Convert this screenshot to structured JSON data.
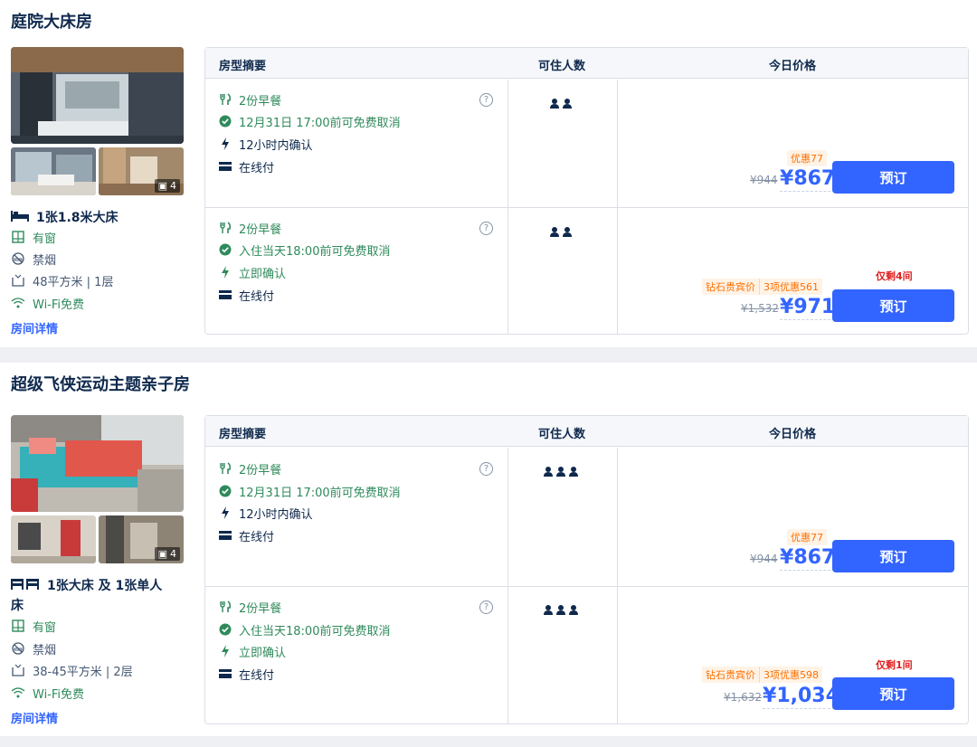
{
  "colors": {
    "accent": "#3264ff",
    "green": "#2f8a5b",
    "orange": "#ff6f00",
    "red": "#e02020"
  },
  "table_headers": {
    "summary": "房型摘要",
    "guests": "可住人数",
    "price": "今日价格"
  },
  "detail_link": "房间详情",
  "book_label": "预订",
  "help_symbol": "?",
  "rooms": [
    {
      "name": "庭院大床房",
      "photo_count": "4",
      "bed": "1张1.8米大床",
      "features": [
        {
          "icon": "window-icon",
          "text": "有窗"
        },
        {
          "icon": "no-smoking-icon",
          "text": "禁烟"
        },
        {
          "icon": "area-icon",
          "text": "48平方米 | 1层"
        },
        {
          "icon": "wifi-icon",
          "text": "Wi-Fi免费"
        }
      ],
      "guests": 2,
      "rates": [
        {
          "breakfast": "2份早餐",
          "cancel": "12月31日 17:00前可免费取消",
          "confirm": "12小时内确认",
          "payment": "在线付",
          "discount": "优惠77",
          "old_price": "¥944",
          "price_symbol": "¥",
          "price": "867"
        },
        {
          "breakfast": "2份早餐",
          "cancel": "入住当天18:00前可免费取消",
          "confirm": "立即确认",
          "payment": "在线付",
          "tag_member": "钻石贵宾价",
          "tag_offers": "3项优惠561",
          "old_price": "¥1,532",
          "price_symbol": "¥",
          "price": "971",
          "stock": "仅剩4间"
        }
      ]
    },
    {
      "name": "超级飞侠运动主题亲子房",
      "photo_count": "4",
      "bed_line1": "1张大床 及 1张单人",
      "bed_line2": "床",
      "features": [
        {
          "icon": "window-icon",
          "text": "有窗"
        },
        {
          "icon": "no-smoking-icon",
          "text": "禁烟"
        },
        {
          "icon": "area-icon",
          "text": "38-45平方米 | 2层"
        },
        {
          "icon": "wifi-icon",
          "text": "Wi-Fi免费"
        }
      ],
      "guests": 3,
      "rates": [
        {
          "breakfast": "2份早餐",
          "cancel": "12月31日 17:00前可免费取消",
          "confirm": "12小时内确认",
          "payment": "在线付",
          "discount": "优惠77",
          "old_price": "¥944",
          "price_symbol": "¥",
          "price": "867"
        },
        {
          "breakfast": "2份早餐",
          "cancel": "入住当天18:00前可免费取消",
          "confirm": "立即确认",
          "payment": "在线付",
          "tag_member": "钻石贵宾价",
          "tag_offers": "3项优惠598",
          "old_price": "¥1,632",
          "price_symbol": "¥",
          "price": "1,034",
          "stock": "仅剩1间"
        }
      ]
    }
  ]
}
